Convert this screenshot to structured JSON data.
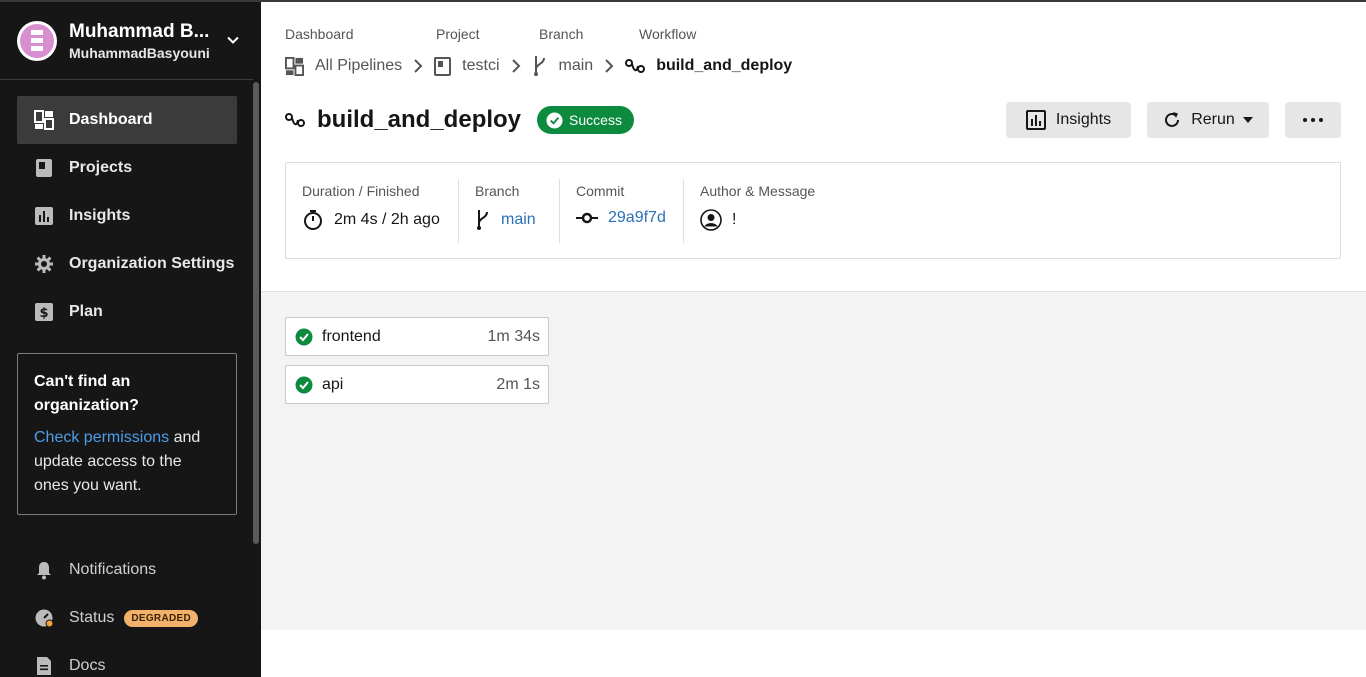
{
  "sidebar": {
    "user_name": "Muhammad B...",
    "user_handle": "MuhammadBasyouni",
    "nav": [
      {
        "label": "Dashboard",
        "icon": "dashboard-icon",
        "active": true
      },
      {
        "label": "Projects",
        "icon": "project-icon"
      },
      {
        "label": "Insights",
        "icon": "insights-icon"
      },
      {
        "label": "Organization Settings",
        "icon": "gear-icon"
      },
      {
        "label": "Plan",
        "icon": "dollar-icon"
      }
    ],
    "promo": {
      "title": "Can't find an organization?",
      "link": "Check permissions",
      "body": " and update access to the ones you want."
    },
    "bottom_nav": [
      {
        "label": "Notifications",
        "icon": "bell-icon"
      },
      {
        "label": "Status",
        "icon": "status-gauge-icon",
        "badge": "DEGRADED"
      },
      {
        "label": "Docs",
        "icon": "document-icon"
      }
    ]
  },
  "breadcrumbs": {
    "labels": [
      "Dashboard",
      "Project",
      "Branch",
      "Workflow"
    ],
    "items": [
      "All Pipelines",
      "testci",
      "main",
      "build_and_deploy"
    ]
  },
  "header": {
    "title": "build_and_deploy",
    "status": "Success",
    "insights_label": "Insights",
    "rerun_label": "Rerun",
    "success_color": "#0c8a3e"
  },
  "info": {
    "duration_label": "Duration / Finished",
    "duration_value": "2m 4s / 2h ago",
    "branch_label": "Branch",
    "branch_value": "main",
    "commit_label": "Commit",
    "commit_value": "29a9f7d",
    "author_label": "Author & Message",
    "author_value": "!"
  },
  "jobs": [
    {
      "name": "frontend",
      "duration": "1m 34s",
      "status": "success"
    },
    {
      "name": "api",
      "duration": "2m 1s",
      "status": "success"
    }
  ]
}
